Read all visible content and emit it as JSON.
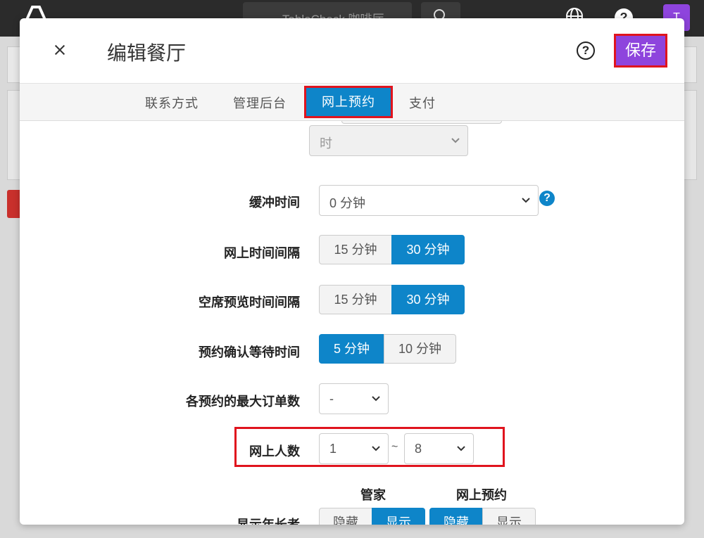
{
  "topbar": {
    "search_text": "TableCheck 咖啡厅",
    "avatar_initial": "T",
    "help_glyph": "?"
  },
  "modal": {
    "title": "编辑餐厅",
    "help_glyph": "?",
    "save_label": "保存"
  },
  "tabs": [
    {
      "label": "联系方式"
    },
    {
      "label": "管理后台"
    },
    {
      "label": "网上预约"
    },
    {
      "label": "支付"
    }
  ],
  "form": {
    "unit_select_value": "时",
    "buffer": {
      "label": "缓冲时间",
      "value": "0 分钟",
      "info": "?"
    },
    "online_interval": {
      "label": "网上时间间隔",
      "options": [
        "15 分钟",
        "30 分钟"
      ],
      "selected": "30 分钟"
    },
    "vacancy_interval": {
      "label": "空席预览时间间隔",
      "options": [
        "15 分钟",
        "30 分钟"
      ],
      "selected": "30 分钟"
    },
    "confirm_wait": {
      "label": "预约确认等待时间",
      "options": [
        "5 分钟",
        "10 分钟"
      ],
      "selected": "5 分钟"
    },
    "max_orders": {
      "label": "各预约的最大订单数",
      "value": "-"
    },
    "online_party": {
      "label": "网上人数",
      "min": "1",
      "separator": "~",
      "max": "8"
    },
    "show_elderly": {
      "label": "显示年长者",
      "columns": [
        "管家",
        "网上预约"
      ],
      "manager": {
        "options": [
          "隐藏",
          "显示"
        ],
        "selected": "显示"
      },
      "online": {
        "options": [
          "隐藏",
          "显示"
        ],
        "selected": "隐藏"
      }
    }
  },
  "colors": {
    "accent": "#8e44dd",
    "primary": "#0e85c9",
    "highlight": "#e0141e"
  }
}
